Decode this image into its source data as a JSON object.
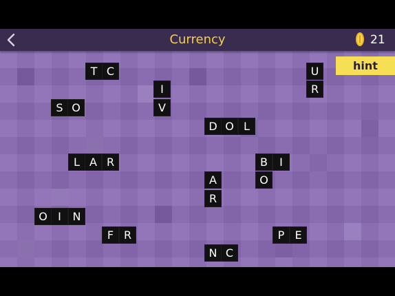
{
  "header": {
    "back_icon": "chevron-left-icon",
    "title": "Currency",
    "coin_icon": "coin-icon",
    "coins": "21"
  },
  "hint_label": "hint",
  "colors": {
    "header_bg": "#3a2c4e",
    "title": "#f3cf4e",
    "board": "#8a6cb4",
    "hint_bg": "#f6df55",
    "tile_bg": "#111111",
    "tile_text": "#ffffff"
  },
  "tile_groups": [
    {
      "letters": "TC"
    },
    {
      "letters": "SO"
    },
    {
      "letters": "IV"
    },
    {
      "letters": "UR"
    },
    {
      "letters": "DOL"
    },
    {
      "letters": "LAR"
    },
    {
      "letters": "BIO"
    },
    {
      "letters": "AR"
    },
    {
      "letters": "OIN"
    },
    {
      "letters": "FR"
    },
    {
      "letters": "PE"
    },
    {
      "letters": "NC"
    }
  ]
}
